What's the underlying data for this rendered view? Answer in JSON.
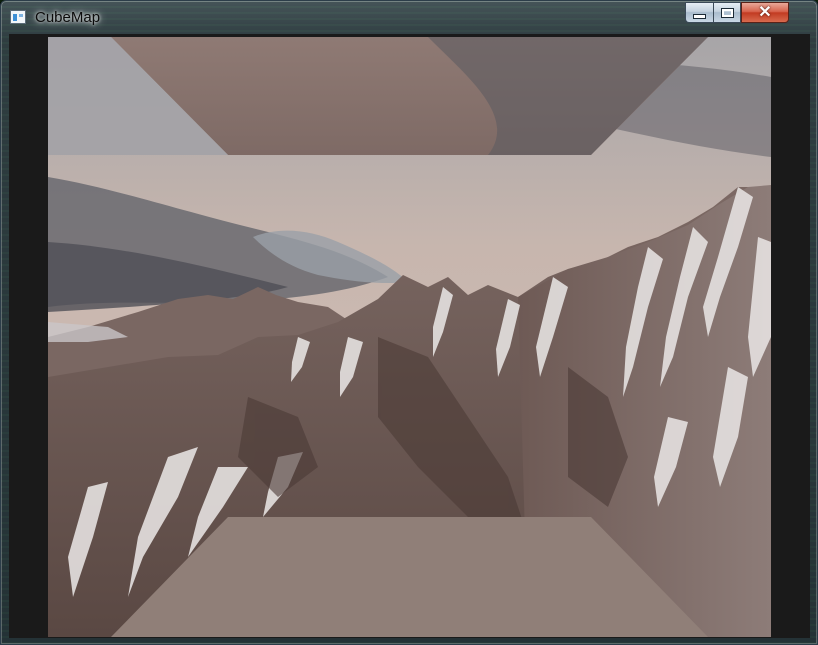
{
  "window": {
    "title": "CubeMap",
    "icon": "app-window-icon"
  },
  "caption_buttons": {
    "minimize": "minimize-icon",
    "maximize": "maximize-icon",
    "close": "close-icon",
    "close_glyph": "✕"
  },
  "scene": {
    "description_icon": "cubemap-skybox-render",
    "colors": {
      "sky": "#c4b3ac",
      "cloud_dark": "#5f5e63",
      "mountain": "#6b5650",
      "snow": "#e9e6e6",
      "cube_face_top": "#8a7570",
      "cube_face_bottom": "#907f78",
      "viewport_border": "#1a1a1a"
    }
  }
}
